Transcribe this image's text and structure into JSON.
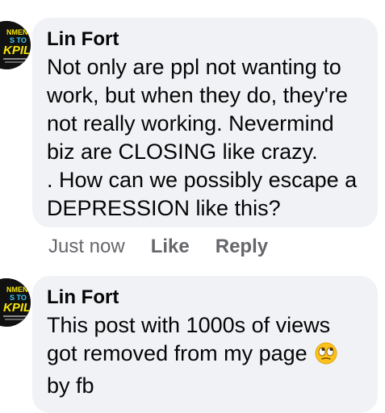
{
  "comments": [
    {
      "author": "Lin Fort",
      "text_lines": [
        "Not only are ppl not wanting to",
        "work, but when they do, they're",
        "not really working.  Nevermind",
        "biz are CLOSING like crazy.",
        ". How can we possibly escape a",
        "DEPRESSION like this?"
      ],
      "time": "Just now",
      "like_label": "Like",
      "reply_label": "Reply"
    },
    {
      "author": "Lin Fort",
      "text_lines": [
        "This post with 1000s of views",
        "got removed from my page",
        "by fb"
      ],
      "emoji": "rolling-eyes-emoji"
    }
  ],
  "avatar_text": {
    "line1": "NMENT",
    "line2": "S TO",
    "line3": "KPILE"
  },
  "colors": {
    "bubble_bg": "#f0f2f5",
    "meta_text": "#65676b",
    "avatar_yellow": "#f5e50a",
    "avatar_cyan": "#3ec7f0"
  }
}
